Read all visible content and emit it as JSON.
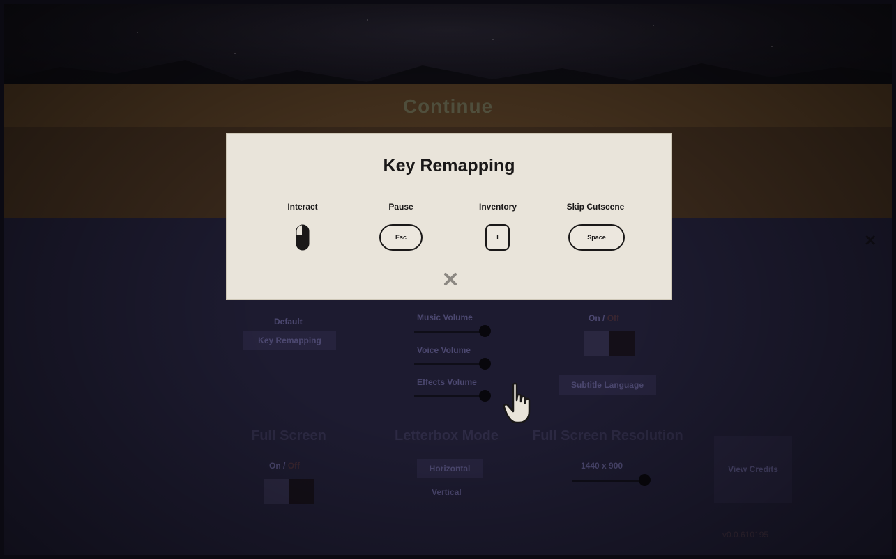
{
  "background": {
    "continue_label": "Continue",
    "left_buttons": [
      "Default",
      "Key Remapping"
    ],
    "volume_labels": [
      "Music Volume",
      "Voice Volume",
      "Effects Volume"
    ],
    "subtitles_toggle_on": "On",
    "subtitles_toggle_sep": "/",
    "subtitles_toggle_off": "Off",
    "subtitle_language_label": "Subtitle Language",
    "full_screen_heading": "Full Screen",
    "full_screen_toggle_on": "On",
    "full_screen_toggle_sep": "/",
    "full_screen_toggle_off": "Off",
    "letterbox_heading": "Letterbox Mode",
    "letterbox_options": [
      "Horizontal",
      "Vertical"
    ],
    "resolution_heading": "Full Screen Resolution",
    "resolution_value": "1440 x 900",
    "view_credits_label": "View Credits",
    "version_label": "v0.0.610195"
  },
  "modal": {
    "title": "Key Remapping",
    "bindings": [
      {
        "action": "Interact",
        "key": "",
        "icon": "mouse-icon"
      },
      {
        "action": "Pause",
        "key": "Esc"
      },
      {
        "action": "Inventory",
        "key": "I"
      },
      {
        "action": "Skip Cutscene",
        "key": "Space"
      }
    ],
    "close_icon": "close-icon"
  },
  "colors": {
    "modal_bg": "#e9e4da",
    "ink": "#1a1818",
    "background_panel": "#1d1b30"
  }
}
